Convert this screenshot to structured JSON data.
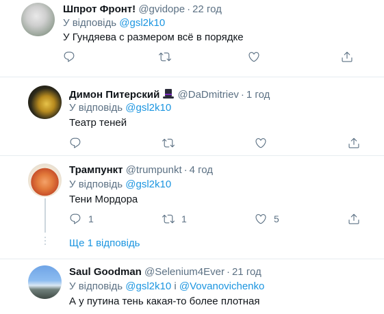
{
  "tweets": [
    {
      "name": "Шпрот Фронт!",
      "handle": "@gvidope",
      "time": "22 год",
      "reply_prefix": "У відповідь",
      "mentions": [
        "@gsl2k10"
      ],
      "text": "У Гундяева с размером всё в порядке",
      "counts": {
        "reply": "",
        "retweet": "",
        "like": ""
      }
    },
    {
      "name": "Димон Питерский",
      "name_emoji": "top-hat",
      "handle": "@DaDmitriev",
      "time": "1 год",
      "reply_prefix": "У відповідь",
      "mentions": [
        "@gsl2k10"
      ],
      "text": "Театр теней",
      "counts": {
        "reply": "",
        "retweet": "",
        "like": ""
      }
    },
    {
      "name": "Трампункт",
      "handle": "@trumpunkt",
      "time": "4 год",
      "reply_prefix": "У відповідь",
      "mentions": [
        "@gsl2k10"
      ],
      "text": "Тени Мордора",
      "counts": {
        "reply": "1",
        "retweet": "1",
        "like": "5"
      }
    },
    {
      "name": "Saul Goodman",
      "handle": "@Selenium4Ever",
      "time": "21 год",
      "reply_prefix": "У відповідь",
      "mentions": [
        "@gsl2k10",
        "@Vovanovichenko"
      ],
      "mention_joiner": "і",
      "text": "А у путина тень какая-то более плотная"
    }
  ],
  "show_more_label": "Ще 1 відповідь",
  "separator": "·",
  "icons": {
    "reply": "reply-icon",
    "retweet": "retweet-icon",
    "like": "heart-icon",
    "share": "share-icon"
  },
  "colors": {
    "text": "#0f1419",
    "secondary": "#5b7083",
    "link": "#1b95e0",
    "divider": "#e6ecf0"
  }
}
